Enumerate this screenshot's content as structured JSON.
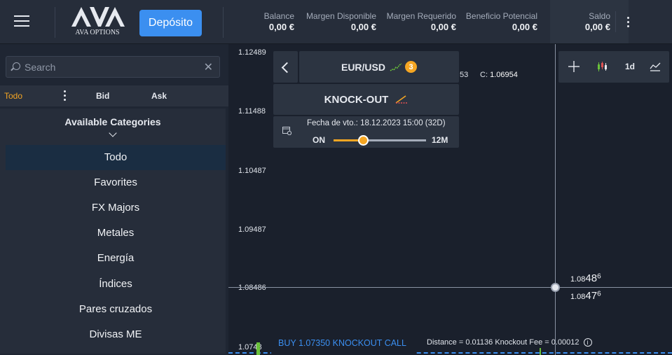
{
  "topbar": {
    "logo_text": "AVA OPTIONS",
    "deposit_label": "Depósito",
    "stats": [
      {
        "label": "Balance",
        "value": "0,00 €"
      },
      {
        "label": "Margen Disponible",
        "value": "0,00 €"
      },
      {
        "label": "Margen Requerido",
        "value": "0,00 €"
      },
      {
        "label": "Beneficio Potencial",
        "value": "0,00 €"
      },
      {
        "label": "Saldo",
        "value": "0,00 €"
      }
    ]
  },
  "search": {
    "placeholder": "Search"
  },
  "columns": {
    "todo": "Todo",
    "bid": "Bid",
    "ask": "Ask"
  },
  "categories": {
    "title": "Available Categories",
    "items": [
      "Todo",
      "Favorites",
      "FX Majors",
      "Metales",
      "Energía",
      "Índices",
      "Pares cruzados",
      "Divisas ME"
    ],
    "active_index": 0
  },
  "chart": {
    "y_labels": [
      "1.12489",
      "1.11488",
      "1.10487",
      "1.09487",
      "1.08486",
      "1.0748"
    ],
    "ask_price": {
      "base": "1.08",
      "big": "48",
      "sup": "6"
    },
    "bid_price": {
      "base": "1.08",
      "big": "47",
      "sup": "6"
    },
    "ohlc_partial": "53",
    "close_label": "C:",
    "close_value": "1.06954",
    "interval": "1d"
  },
  "instrument": {
    "pair": "EUR/USD",
    "badge": "3",
    "product": "KNOCK-OUT",
    "expiry": "Fecha de vto.: 18.12.2023 15:00 (32D)",
    "slider_min": "ON",
    "slider_max": "12M",
    "slider_value": 0.32
  },
  "order": {
    "buy_label": "BUY 1.07350 KNOCKOUT CALL",
    "distance_text": "Distance = 0.01136 Knockout Fee = 0.00012",
    "info_glyph": "i"
  },
  "colors": {
    "accent": "#3b8ff0",
    "orange": "#f5a623",
    "green": "#6ac13a"
  }
}
